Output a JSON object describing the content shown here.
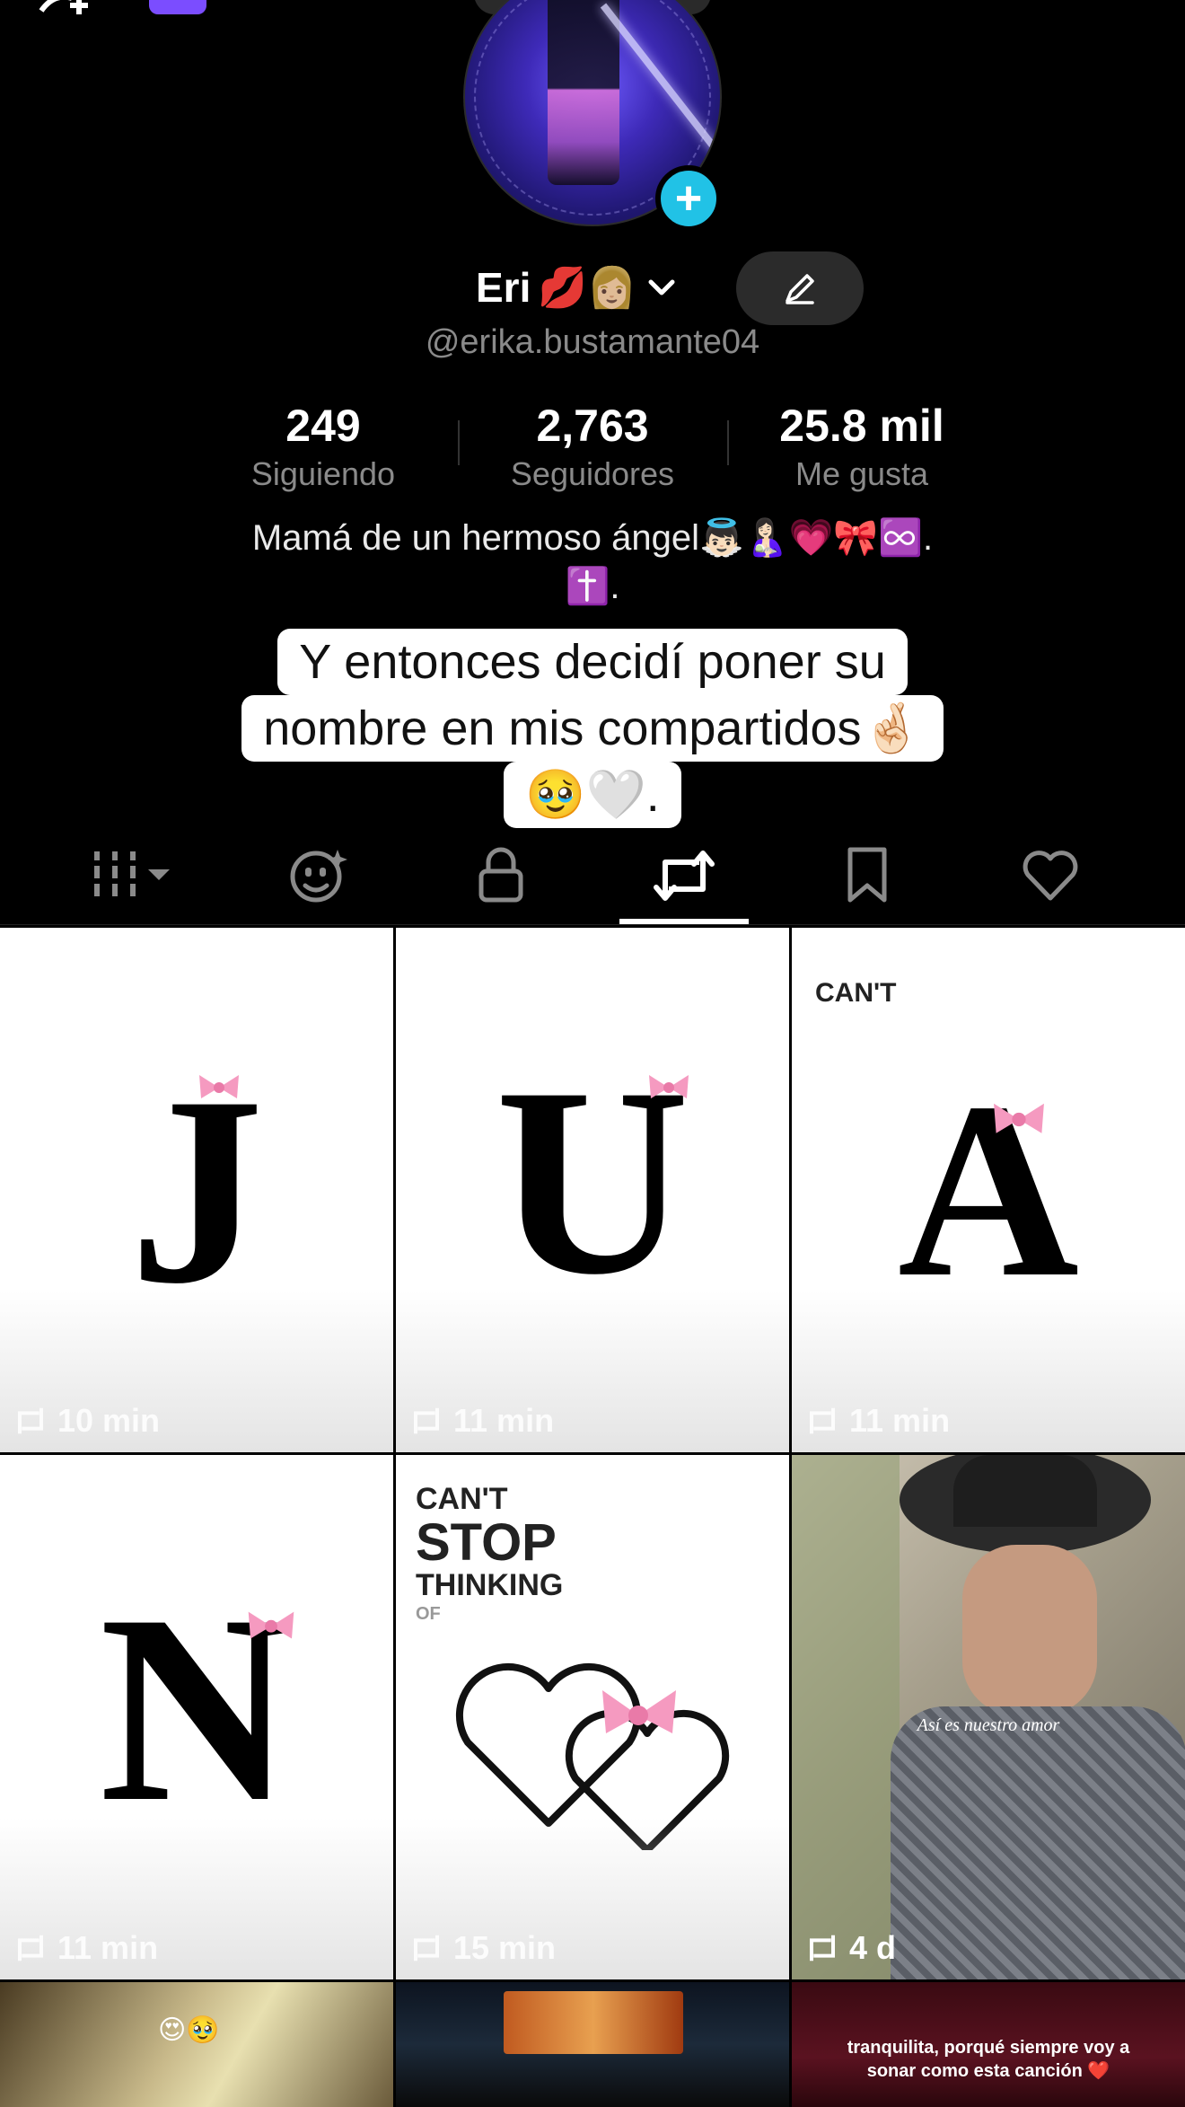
{
  "profile": {
    "display_name": "Eri",
    "name_emoji": "💋👩🏼",
    "username": "@erika.bustamante04",
    "bio_line1": "Mamá de un hermoso ángel👼🏻🤱🏻💗🎀♾️.",
    "bio_line2": "✝️."
  },
  "stats": [
    {
      "value": "249",
      "label": "Siguiendo"
    },
    {
      "value": "2,763",
      "label": "Seguidores"
    },
    {
      "value": "25.8 mil",
      "label": "Me gusta"
    }
  ],
  "caption": {
    "line1": "Y entonces decidí poner su",
    "line2": "nombre en mis compartidos🤞🏻",
    "line3": "🥹🤍."
  },
  "tabs": [
    {
      "icon": "grid-icon",
      "active": false
    },
    {
      "icon": "face-sparkle-icon",
      "active": false
    },
    {
      "icon": "lock-icon",
      "active": false
    },
    {
      "icon": "repost-icon",
      "active": true
    },
    {
      "icon": "bookmark-icon",
      "active": false
    },
    {
      "icon": "heart-icon",
      "active": false
    }
  ],
  "grid": [
    {
      "letter": "J",
      "time": "10 min"
    },
    {
      "letter": "U",
      "time": "11 min"
    },
    {
      "letter": "A",
      "top_text": "CAN'T",
      "time": "11 min"
    },
    {
      "letter": "N",
      "time": "11 min"
    },
    {
      "top_text_1": "CAN'T",
      "top_text_2": "STOP",
      "top_text_3": "THINKING",
      "top_text_4": "OF",
      "time": "15 min"
    },
    {
      "overlay_text": "Así es nuestro amor",
      "time": "4 d"
    },
    {
      "time": ""
    },
    {
      "time": ""
    },
    {
      "overlay_text_1": "tranquilita, porqué siempre voy a",
      "overlay_text_2": "sonar como esta canción ❤️"
    }
  ],
  "colors": {
    "accent": "#21c2e6",
    "background": "#000000",
    "muted_text": "#8a8a8a"
  }
}
